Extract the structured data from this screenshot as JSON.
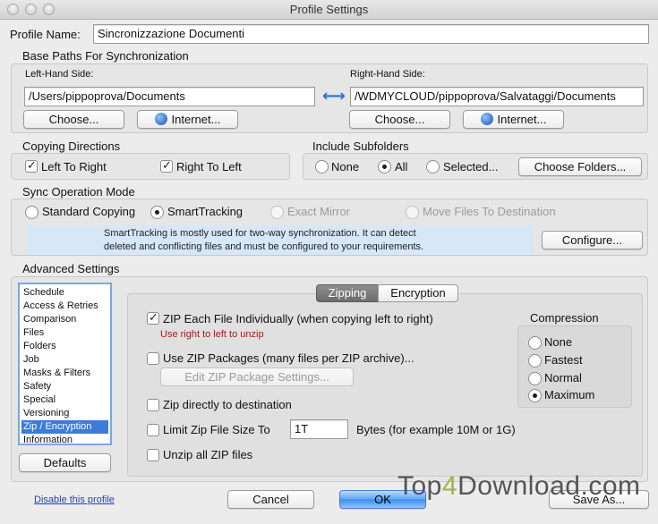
{
  "window": {
    "title": "Profile Settings"
  },
  "profile": {
    "label": "Profile Name:",
    "value": "Sincronizzazione Documenti"
  },
  "base_paths": {
    "heading": "Base Paths For Synchronization",
    "left_label": "Left-Hand Side:",
    "left_path": "/Users/pippoprova/Documents",
    "right_label": "Right-Hand Side:",
    "right_path": "/WDMYCLOUD/pippoprova/Salvataggi/Documents",
    "choose_label": "Choose...",
    "internet_label": "Internet...",
    "swap_glyph": "⟷"
  },
  "copying": {
    "heading": "Copying Directions",
    "left_to_right": "Left To Right",
    "right_to_left": "Right To Left"
  },
  "subfolders": {
    "heading": "Include Subfolders",
    "none": "None",
    "all": "All",
    "selected": "Selected...",
    "choose_folders": "Choose Folders..."
  },
  "sync_mode": {
    "heading": "Sync Operation Mode",
    "standard": "Standard Copying",
    "smart": "SmartTracking",
    "mirror": "Exact Mirror",
    "move": "Move Files To Destination",
    "info_line1": "SmartTracking is mostly used for two-way synchronization. It can detect",
    "info_line2": "deleted and conflicting files and must be configured to your requirements.",
    "configure": "Configure..."
  },
  "advanced": {
    "heading": "Advanced Settings",
    "items": [
      "Schedule",
      "Access & Retries",
      "Comparison",
      "Files",
      "Folders",
      "Job",
      "Masks & Filters",
      "Safety",
      "Special",
      "Versioning",
      "Zip / Encryption",
      "Information"
    ],
    "defaults": "Defaults"
  },
  "tabs": {
    "zipping": "Zipping",
    "encryption": "Encryption"
  },
  "zipping": {
    "zip_each": "ZIP Each File Individually (when copying left to right)",
    "zip_each_hint": "Use right to left to unzip",
    "zip_packages": "Use ZIP Packages (many files per ZIP archive)...",
    "edit_package": "Edit ZIP Package Settings...",
    "zip_directly": "Zip directly to destination",
    "limit_size": "Limit Zip File Size To",
    "limit_value": "1T",
    "limit_hint": "Bytes (for example 10M or 1G)",
    "unzip_all": "Unzip all ZIP files"
  },
  "compression": {
    "heading": "Compression",
    "none": "None",
    "fastest": "Fastest",
    "normal": "Normal",
    "maximum": "Maximum"
  },
  "footer": {
    "disable_link": "Disable this profile",
    "cancel": "Cancel",
    "ok": "OK",
    "save_as": "Save As..."
  },
  "watermark": {
    "part1": "Top",
    "part2": "4",
    "part3": "Download.com"
  }
}
